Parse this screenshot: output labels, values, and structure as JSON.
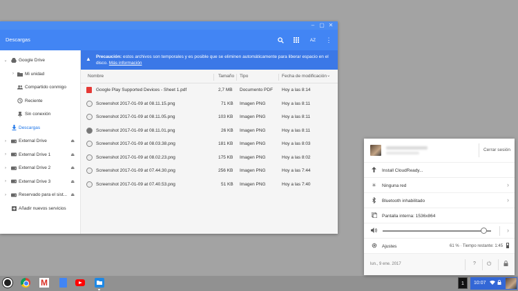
{
  "window": {
    "title": "Descargas",
    "sort_label": "AZ"
  },
  "sidebar": {
    "items": [
      {
        "label": "Google Drive"
      },
      {
        "label": "Mi unidad"
      },
      {
        "label": "Compartido conmigo"
      },
      {
        "label": "Reciente"
      },
      {
        "label": "Sin conexión"
      },
      {
        "label": "Descargas"
      },
      {
        "label": "External Drive"
      },
      {
        "label": "External Drive 1"
      },
      {
        "label": "External Drive 2"
      },
      {
        "label": "External Drive 3"
      },
      {
        "label": "Reservado para el sist..."
      },
      {
        "label": "Añadir nuevos servicios"
      }
    ]
  },
  "banner": {
    "bold": "Precaución:",
    "text": " estos archivos son temporales y es posible que se eliminen automáticamente para liberar espacio en el disco. ",
    "link": "Más información"
  },
  "columns": {
    "name": "Nombre",
    "size": "Tamaño",
    "type": "Tipo",
    "modified": "Fecha de modificación",
    "sort_arrow": "⌄"
  },
  "files": [
    {
      "name": "Google Play Supported Devices - Sheet 1.pdf",
      "size": "2,7 MB",
      "type": "Documento PDF",
      "date": "Hoy a las 8:14"
    },
    {
      "name": "Screenshot 2017-01-09 at 08.11.15.png",
      "size": "71 KB",
      "type": "Imagen PNG",
      "date": "Hoy a las 8:11"
    },
    {
      "name": "Screenshot 2017-01-09 at 08.11.05.png",
      "size": "103 KB",
      "type": "Imagen PNG",
      "date": "Hoy a las 8:11"
    },
    {
      "name": "Screenshot 2017-01-09 at 08.11.01.png",
      "size": "26 KB",
      "type": "Imagen PNG",
      "date": "Hoy a las 8:11"
    },
    {
      "name": "Screenshot 2017-01-09 at 08.03.38.png",
      "size": "181 KB",
      "type": "Imagen PNG",
      "date": "Hoy a las 8:03"
    },
    {
      "name": "Screenshot 2017-01-09 at 08.02.23.png",
      "size": "175 KB",
      "type": "Imagen PNG",
      "date": "Hoy a las 8:02"
    },
    {
      "name": "Screenshot 2017-01-09 at 07.44.30.png",
      "size": "256 KB",
      "type": "Imagen PNG",
      "date": "Hoy a las 7:44"
    },
    {
      "name": "Screenshot 2017-01-09 at 07.40.53.png",
      "size": "51 KB",
      "type": "Imagen PNG",
      "date": "Hoy a las 7:40"
    }
  ],
  "tray": {
    "sign_out": "Cerrar sesión",
    "install": "Install CloudReady...",
    "network": "Ninguna red",
    "bluetooth": "Bluetooth inhabilitado",
    "display": "Pantalla interna: 1536x864",
    "volume_level": 0.93,
    "settings": "Ajustes",
    "battery": "61 %  ·  Tiempo restante: 1:45",
    "date": "lun., 9 ene. 2017",
    "help": "?"
  },
  "shelf": {
    "badge": "1",
    "time": "10:07"
  }
}
